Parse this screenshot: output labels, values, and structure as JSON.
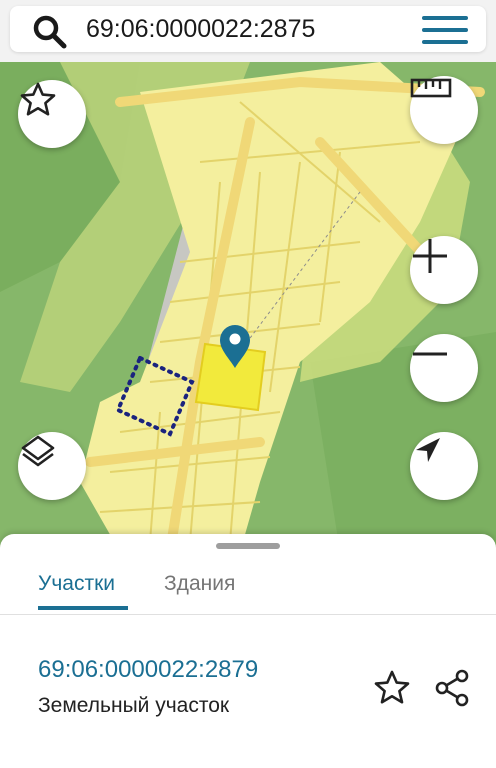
{
  "search": {
    "query": "69:06:0000022:2875"
  },
  "icons": {
    "search": "search-icon",
    "menu": "menu-icon",
    "favorite": "star-icon",
    "ruler": "ruler-icon",
    "zoom_in": "plus-icon",
    "zoom_out": "minus-icon",
    "layers": "layers-icon",
    "locate": "navigation-arrow-icon",
    "pin": "location-pin-icon",
    "share": "share-icon"
  },
  "bottom_sheet": {
    "tabs": [
      {
        "label": "Участки",
        "active": true
      },
      {
        "label": "Здания",
        "active": false
      }
    ],
    "result": {
      "number": "69:06:0000022:2879",
      "type": "Земельный участок"
    }
  },
  "colors": {
    "accent": "#1b6f93",
    "selected_parcel": "#f2ea3c",
    "parcel_fill": "#f4ef9e",
    "forest": "#86b76a",
    "road": "#f0d877",
    "outline_dotted": "#1a237e"
  }
}
